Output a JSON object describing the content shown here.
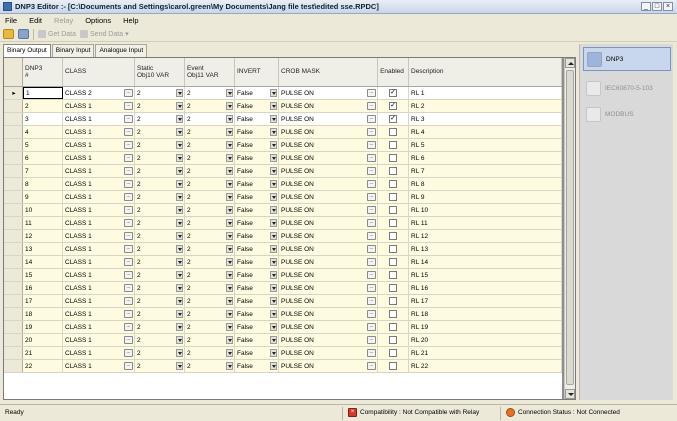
{
  "window": {
    "title": "DNP3 Editor :- [C:\\Documents and Settings\\carol.green\\My Documents\\Jang file test\\edited sse.RPDC]",
    "controls": [
      "_",
      "□",
      "×"
    ]
  },
  "menu": [
    "File",
    "Edit",
    "Relay",
    "Options",
    "Help"
  ],
  "toolbar": {
    "get_data": "Get Data",
    "send_data": "Send Data",
    "send_arrow": "▾"
  },
  "tabs": [
    "Binary Output",
    "Binary Input",
    "Analogue Input"
  ],
  "columns": {
    "num": "DNP3\n#",
    "class": "CLASS",
    "static": "Static\nObj10 VAR",
    "event": "Event\nObj11 VAR",
    "invert": "INVERT",
    "crob": "CROB MASK",
    "enabled": "Enabled",
    "description": "Description"
  },
  "rows": [
    {
      "num": "1",
      "cls": "CLASS 2",
      "st": "2",
      "ev": "2",
      "inv": "False",
      "crob": "PULSE ON",
      "en": true,
      "desc": "RL 1"
    },
    {
      "num": "2",
      "cls": "CLASS 1",
      "st": "2",
      "ev": "2",
      "inv": "False",
      "crob": "PULSE ON",
      "en": true,
      "desc": "RL 2"
    },
    {
      "num": "3",
      "cls": "CLASS 1",
      "st": "2",
      "ev": "2",
      "inv": "False",
      "crob": "PULSE ON",
      "en": true,
      "desc": "RL 3"
    },
    {
      "num": "4",
      "cls": "CLASS 1",
      "st": "2",
      "ev": "2",
      "inv": "False",
      "crob": "PULSE ON",
      "en": false,
      "desc": "RL 4"
    },
    {
      "num": "5",
      "cls": "CLASS 1",
      "st": "2",
      "ev": "2",
      "inv": "False",
      "crob": "PULSE ON",
      "en": false,
      "desc": "RL 5"
    },
    {
      "num": "6",
      "cls": "CLASS 1",
      "st": "2",
      "ev": "2",
      "inv": "False",
      "crob": "PULSE ON",
      "en": false,
      "desc": "RL 6"
    },
    {
      "num": "7",
      "cls": "CLASS 1",
      "st": "2",
      "ev": "2",
      "inv": "False",
      "crob": "PULSE ON",
      "en": false,
      "desc": "RL 7"
    },
    {
      "num": "8",
      "cls": "CLASS 1",
      "st": "2",
      "ev": "2",
      "inv": "False",
      "crob": "PULSE ON",
      "en": false,
      "desc": "RL 8"
    },
    {
      "num": "9",
      "cls": "CLASS 1",
      "st": "2",
      "ev": "2",
      "inv": "False",
      "crob": "PULSE ON",
      "en": false,
      "desc": "RL 9"
    },
    {
      "num": "10",
      "cls": "CLASS 1",
      "st": "2",
      "ev": "2",
      "inv": "False",
      "crob": "PULSE ON",
      "en": false,
      "desc": "RL 10"
    },
    {
      "num": "11",
      "cls": "CLASS 1",
      "st": "2",
      "ev": "2",
      "inv": "False",
      "crob": "PULSE ON",
      "en": false,
      "desc": "RL 11"
    },
    {
      "num": "12",
      "cls": "CLASS 1",
      "st": "2",
      "ev": "2",
      "inv": "False",
      "crob": "PULSE ON",
      "en": false,
      "desc": "RL 12"
    },
    {
      "num": "13",
      "cls": "CLASS 1",
      "st": "2",
      "ev": "2",
      "inv": "False",
      "crob": "PULSE ON",
      "en": false,
      "desc": "RL 13"
    },
    {
      "num": "14",
      "cls": "CLASS 1",
      "st": "2",
      "ev": "2",
      "inv": "False",
      "crob": "PULSE ON",
      "en": false,
      "desc": "RL 14"
    },
    {
      "num": "15",
      "cls": "CLASS 1",
      "st": "2",
      "ev": "2",
      "inv": "False",
      "crob": "PULSE ON",
      "en": false,
      "desc": "RL 15"
    },
    {
      "num": "16",
      "cls": "CLASS 1",
      "st": "2",
      "ev": "2",
      "inv": "False",
      "crob": "PULSE ON",
      "en": false,
      "desc": "RL 16"
    },
    {
      "num": "17",
      "cls": "CLASS 1",
      "st": "2",
      "ev": "2",
      "inv": "False",
      "crob": "PULSE ON",
      "en": false,
      "desc": "RL 17"
    },
    {
      "num": "18",
      "cls": "CLASS 1",
      "st": "2",
      "ev": "2",
      "inv": "False",
      "crob": "PULSE ON",
      "en": false,
      "desc": "RL 18"
    },
    {
      "num": "19",
      "cls": "CLASS 1",
      "st": "2",
      "ev": "2",
      "inv": "False",
      "crob": "PULSE ON",
      "en": false,
      "desc": "RL 19"
    },
    {
      "num": "20",
      "cls": "CLASS 1",
      "st": "2",
      "ev": "2",
      "inv": "False",
      "crob": "PULSE ON",
      "en": false,
      "desc": "RL 20"
    },
    {
      "num": "21",
      "cls": "CLASS 1",
      "st": "2",
      "ev": "2",
      "inv": "False",
      "crob": "PULSE ON",
      "en": false,
      "desc": "RL 21"
    },
    {
      "num": "22",
      "cls": "CLASS 1",
      "st": "2",
      "ev": "2",
      "inv": "False",
      "crob": "PULSE ON",
      "en": false,
      "desc": "RL 22"
    }
  ],
  "ui": {
    "row_pointer": "▸",
    "ellipsis": "...",
    "check_mark": "✓"
  },
  "protocols": [
    {
      "label": "DNP3",
      "active": true
    },
    {
      "label": "IEC60870-5-103",
      "active": false
    },
    {
      "label": "MODBUS",
      "active": false
    }
  ],
  "status": {
    "ready": "Ready",
    "compatibility": "Compatibility : Not Compatible with Relay",
    "connection": "Connection Status : Not Connected",
    "error_glyph": "×"
  },
  "colors": {
    "even_row": "#fffbe0",
    "active_protocol": "#c8d6ee",
    "error": "#d23b2b"
  }
}
